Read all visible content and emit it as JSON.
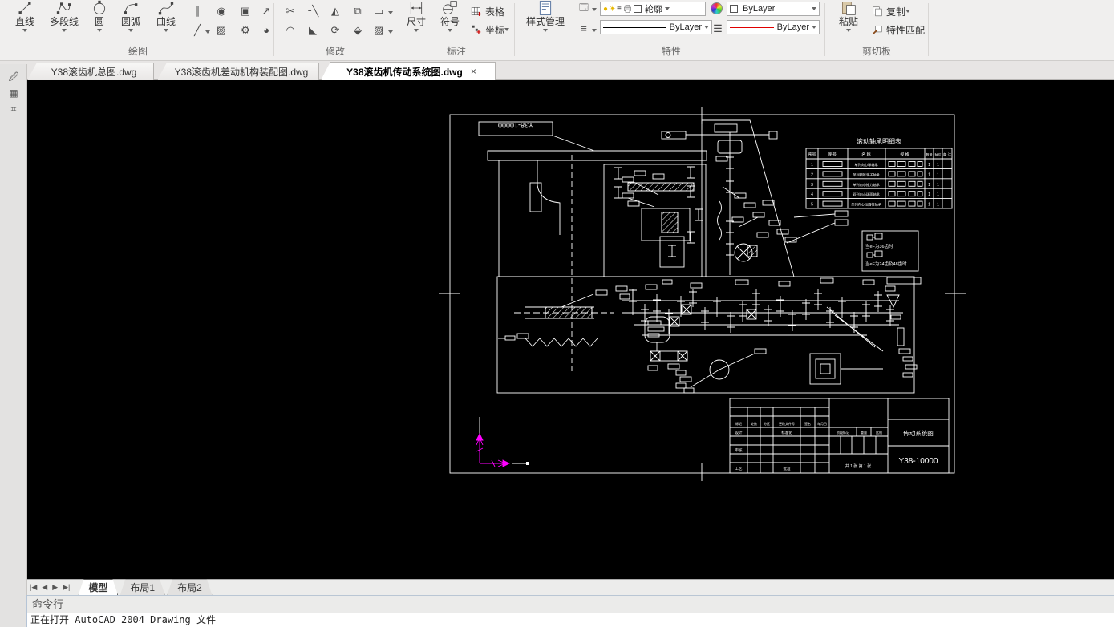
{
  "window": {
    "canvas_bg": "#000000",
    "drawing_line_color": "#ffffff",
    "ucs_color": "#ff00ff"
  },
  "ribbon": {
    "draw": {
      "label": "绘图",
      "buttons": [
        "直线",
        "多段线",
        "圆",
        "圆弧",
        "曲线"
      ]
    },
    "modify": {
      "label": "修改"
    },
    "annotate": {
      "label": "标注",
      "dim": "尺寸",
      "symbol": "符号",
      "table": "表格",
      "coord": "坐标"
    },
    "properties": {
      "label": "特性",
      "style_manager": "样式管理",
      "layer_value": "轮廓",
      "color_value": "ByLayer",
      "lineweight_value": "ByLayer",
      "linetype_value": "ByLayer",
      "linetype_preview_color": "#ff0000"
    },
    "clipboard": {
      "label": "剪切板",
      "paste": "粘贴",
      "copy": "复制",
      "match_props": "特性匹配"
    }
  },
  "doc_tabs": [
    {
      "label": "Y38滚齿机总图.dwg"
    },
    {
      "label": "Y38滚齿机差动机构装配图.dwg"
    },
    {
      "label": "Y38滚齿机传动系统图.dwg",
      "close": "×"
    }
  ],
  "drawing": {
    "sheet_label": "Y38-10000",
    "bearing_table": {
      "title": "滚动轴承明细表",
      "headers": [
        "序号",
        "图号",
        "名 称",
        "规 格",
        "数量",
        "轴位",
        "备 注"
      ],
      "rows": [
        {
          "no": "1",
          "name": "单列向心球轴承",
          "qty": "1",
          "pos": "1"
        },
        {
          "no": "2",
          "name": "单列圆锥滚子轴承",
          "qty": "1",
          "pos": "1"
        },
        {
          "no": "3",
          "name": "单列向心推力轴承",
          "qty": "1",
          "pos": "1"
        },
        {
          "no": "4",
          "name": "双列向心球面轴承",
          "qty": "1",
          "pos": "1"
        },
        {
          "no": "5",
          "name": "单列向心短圆柱轴承",
          "qty": "1",
          "pos": "1"
        }
      ]
    },
    "notes": {
      "line1": "当eF为36齿时",
      "line2": "当eF为24齿及48齿时"
    },
    "title_block": {
      "cols": [
        "标记",
        "处数",
        "分区",
        "更改文件号",
        "签名",
        "年月日"
      ],
      "design": "设计",
      "standard": "标准化",
      "audit": "审核",
      "process": "工艺",
      "approve": "批准",
      "stage": "阶段标记",
      "weight": "重量",
      "scale": "比例",
      "sheet_info": "共 1 张  第 1 张",
      "title": "传动系统图",
      "number": "Y38-10000"
    }
  },
  "layout_tabs": {
    "model": "模型",
    "layout1": "布局1",
    "layout2": "布局2"
  },
  "command": {
    "title": "命令行",
    "text": "正在打开 AutoCAD 2004 Drawing 文件"
  }
}
